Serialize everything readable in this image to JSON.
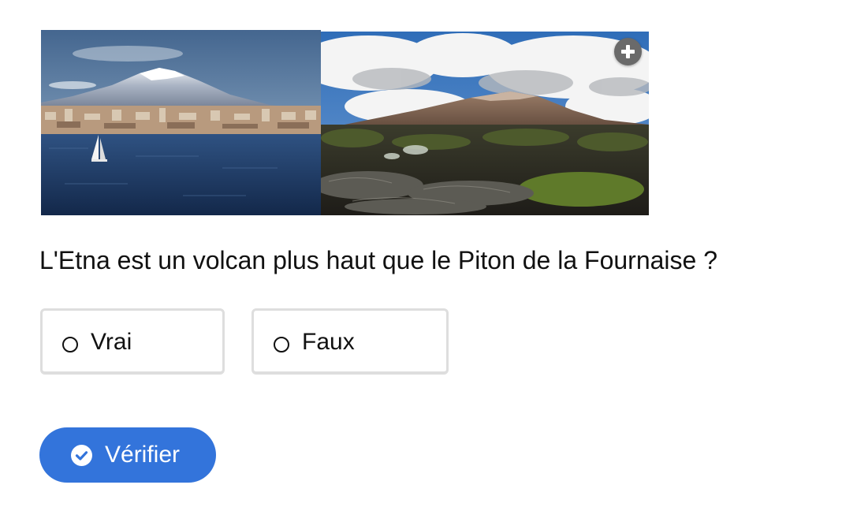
{
  "images": [
    {
      "name": "etna-photo",
      "icon": "etna-landscape-photo"
    },
    {
      "name": "piton-photo",
      "icon": "piton-de-la-fournaise-photo"
    }
  ],
  "zoom": {
    "icon": "plus-circle-icon"
  },
  "question": {
    "text": "L'Etna est un volcan plus haut que le Piton de la Fournaise ?"
  },
  "answers": [
    {
      "label": "Vrai",
      "selected": false
    },
    {
      "label": "Faux",
      "selected": false
    }
  ],
  "verify": {
    "label": "Vérifier",
    "icon": "check-circle-icon",
    "color": "#3374db"
  }
}
